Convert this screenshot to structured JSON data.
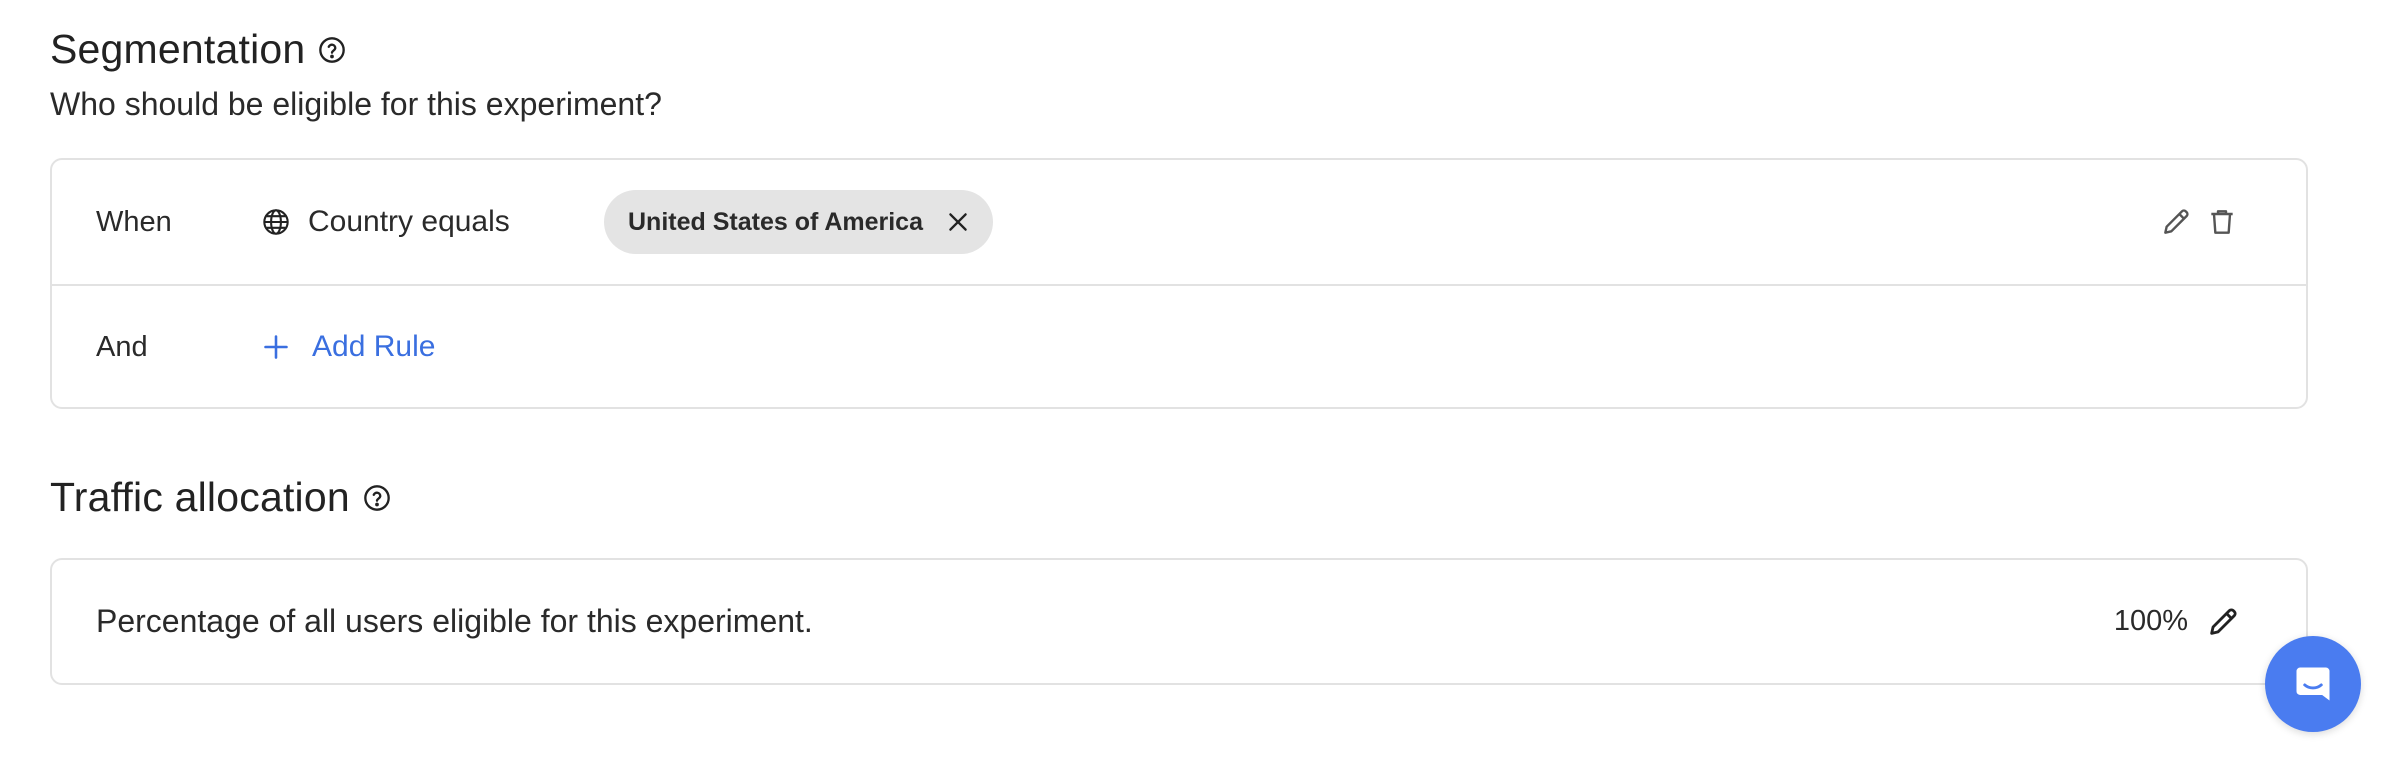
{
  "segmentation": {
    "title": "Segmentation",
    "help_icon": "question-circle-icon",
    "subtitle": "Who should be eligible for this experiment?",
    "rules": [
      {
        "connector": "When",
        "icon": "globe-icon",
        "condition": "Country equals",
        "values": [
          "United States of America"
        ]
      }
    ],
    "and_label": "And",
    "add_rule_label": "Add Rule"
  },
  "traffic": {
    "title": "Traffic allocation",
    "help_icon": "question-circle-icon",
    "description": "Percentage of all users eligible for this experiment.",
    "value": "100%"
  },
  "colors": {
    "accent": "#3a6fe0",
    "chat_launcher": "#4a7cf0",
    "chip_bg": "#e4e4e4",
    "border": "#e2e2e2"
  }
}
